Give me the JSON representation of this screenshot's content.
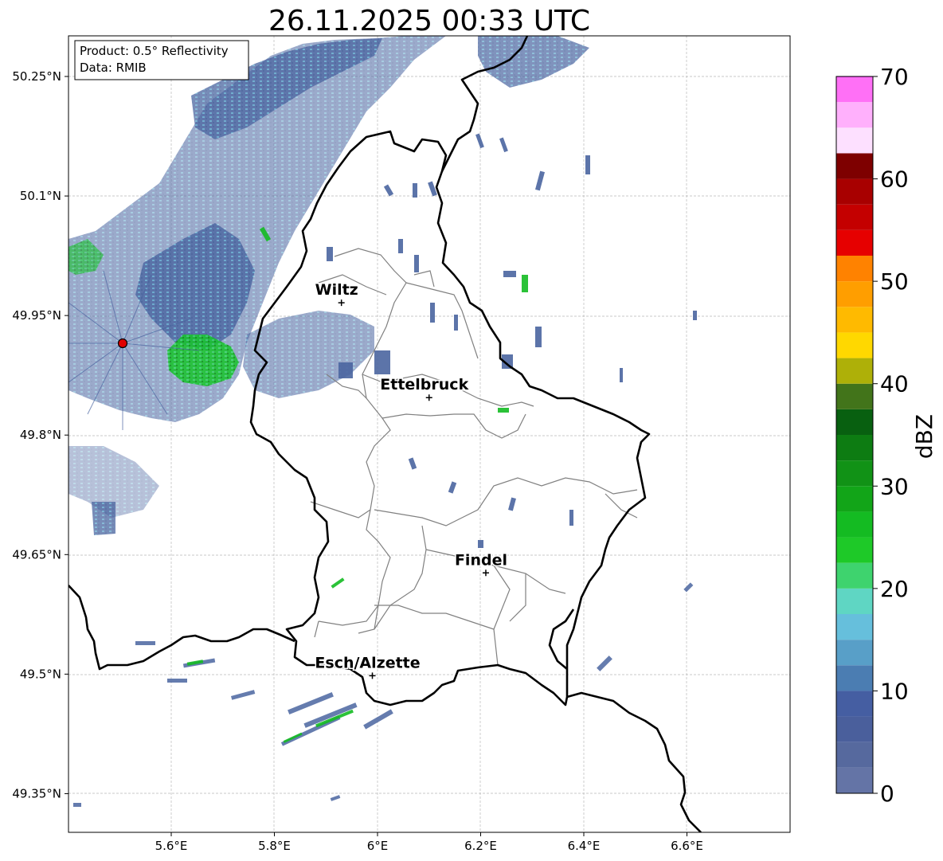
{
  "title": "26.11.2025 00:33 UTC",
  "info": {
    "product": "Product: 0.5° Reflectivity",
    "data": "Data: RMIB"
  },
  "lat_ticks": [
    "50.25°N",
    "50.1°N",
    "49.95°N",
    "49.8°N",
    "49.65°N",
    "49.5°N",
    "49.35°N"
  ],
  "lon_ticks": [
    "5.6°E",
    "5.8°E",
    "6°E",
    "6.2°E",
    "6.4°E",
    "6.6°E"
  ],
  "cities": [
    {
      "name": "Wiltz",
      "lon": 5.93,
      "lat": 49.966
    },
    {
      "name": "Ettelbruck",
      "lon": 6.1,
      "lat": 49.847
    },
    {
      "name": "Findel",
      "lon": 6.21,
      "lat": 49.627
    },
    {
      "name": "Esch/Alzette",
      "lon": 5.99,
      "lat": 49.498
    }
  ],
  "radar_site": {
    "lon": 5.505,
    "lat": 49.914
  },
  "colorbar": {
    "label": "dBZ",
    "ticks": [
      "0",
      "10",
      "20",
      "30",
      "40",
      "50",
      "60",
      "70"
    ],
    "colors": [
      "#6474a6",
      "#56699e",
      "#4a5f9c",
      "#455ea2",
      "#4b7db2",
      "#589fc8",
      "#66bfdc",
      "#5fd6c3",
      "#3ed36e",
      "#1ec928",
      "#14bb22",
      "#12a518",
      "#119216",
      "#0d7c12",
      "#086010",
      "#42741a",
      "#aeb008",
      "#ffd800",
      "#ffba00",
      "#ff9e00",
      "#ff8200",
      "#e60000",
      "#c40000",
      "#a80000",
      "#7e0000",
      "#fde0ff",
      "#ffb0fc",
      "#ff70f6",
      "#e83ae8"
    ],
    "ymin": 0,
    "ymax": 70
  }
}
